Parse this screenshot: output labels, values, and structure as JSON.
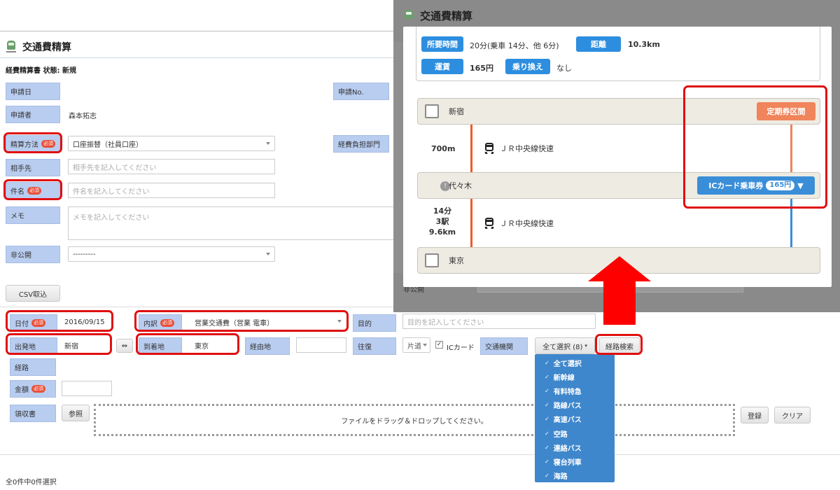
{
  "main": {
    "title": "交通費精算",
    "status": "経費精算書 状態: 新規",
    "labels": {
      "apply_date": "申請日",
      "apply_no": "申請No.",
      "applicant": "申請者",
      "settlement": "精算方法",
      "burden_dept": "経費負担部門",
      "partner": "相手先",
      "subject": "件名",
      "memo": "メモ",
      "private": "非公開",
      "date": "日付",
      "breakdown": "内訳",
      "purpose": "目的",
      "departure": "出発地",
      "arrival": "到着地",
      "via": "経由地",
      "roundtrip": "往復",
      "transport": "交通機関",
      "route": "経路",
      "amount": "金額",
      "receipt": "領収書"
    },
    "required_badge": "必須",
    "applicant_name": "森本拓志",
    "settlement_value": "口座振替（社員口座）",
    "partner_placeholder": "相手先を記入してください",
    "subject_placeholder": "件名を記入してください",
    "memo_placeholder": "メモを記入してください",
    "private_value": "---------",
    "csv_button": "CSV取込",
    "date_value": "2016/09/15",
    "breakdown_value": "営業交通費（営業 電車）",
    "purpose_placeholder": "目的を記入してください",
    "departure_value": "新宿",
    "swap_icon": "⇔",
    "arrival_value": "東京",
    "roundtrip_value": "片道",
    "ic_card_label": "ICカード",
    "transport_select": "全て選択 (8)",
    "route_search_button": "経路検索",
    "browse_button": "参照",
    "drop_text": "ファイルをドラッグ＆ドロップしてください。",
    "register_button": "登録",
    "clear_button": "クリア",
    "footer_status": "全0件中0件選択",
    "transport_menu": [
      "全て選択",
      "新幹線",
      "有料特急",
      "路線バス",
      "高速バス",
      "空路",
      "連絡バス",
      "寝台列車",
      "海路"
    ]
  },
  "overlay": {
    "title": "交通費精算",
    "summary": {
      "time_label": "所要時間",
      "time_value": "20分(乗車 14分、他 6分)",
      "distance_label": "距離",
      "distance_value": "10.3km",
      "fare_label": "運賃",
      "fare_value": "165円",
      "transfer_label": "乗り換え",
      "transfer_value": "なし"
    },
    "stations": [
      "新宿",
      "代々木",
      "東京"
    ],
    "segment1": {
      "distance": "700m",
      "line": "ＪＲ中央線快速"
    },
    "segment2": {
      "time": "14分",
      "stops": "3駅",
      "distance": "9.6km",
      "line": "ＪＲ中央線快速"
    },
    "commuter_button": "定期券区間",
    "ic_button": "ICカード乗車券",
    "ic_price": "165円",
    "bg_private_label": "非公開"
  },
  "colors": {
    "label_bg": "#b9cdf0",
    "highlight_red": "#e01010",
    "pill_blue": "#2d8ee0",
    "route_orange": "#f05a28",
    "route_blue": "#3a8ed8",
    "commuter_orange": "#f0845a"
  }
}
